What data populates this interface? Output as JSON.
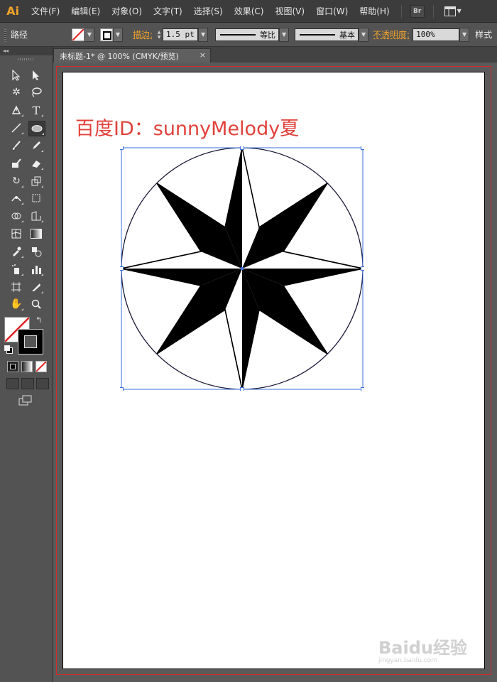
{
  "app": {
    "logo": "Ai"
  },
  "menu": {
    "items": [
      "文件(F)",
      "编辑(E)",
      "对象(O)",
      "文字(T)",
      "选择(S)",
      "效果(C)",
      "视图(V)",
      "窗口(W)",
      "帮助(H)"
    ],
    "bridge_label": "Br"
  },
  "control_bar": {
    "selection_type": "路径",
    "stroke_label": "描边:",
    "stroke_weight": "1.5 pt",
    "stroke_profile": "等比",
    "brush_profile": "基本",
    "opacity_label": "不透明度:",
    "opacity_value": "100%",
    "style_label": "样式"
  },
  "document": {
    "tab_title": "未标题-1* @ 100% (CMYK/预览)",
    "close_glyph": "×"
  },
  "artboard": {
    "text": "百度ID：sunnyMelody夏"
  },
  "watermark": {
    "brand": "Baidu经验",
    "url": "jingyan.baidu.com"
  },
  "colors": {
    "accent_orange": "#f0a32a",
    "selection_blue": "#3a6fd8",
    "artboard_text_red": "#e1413a",
    "bleed_red": "#d42a2a"
  }
}
